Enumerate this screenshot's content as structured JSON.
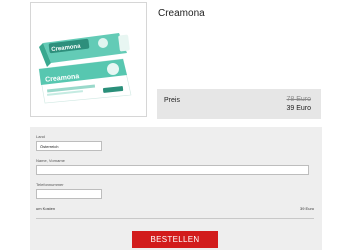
{
  "product": {
    "title": "Creamona",
    "image_alt": "Creamona tube and box",
    "tube_brand": "Creamona",
    "box_brand": "Creamona"
  },
  "price": {
    "label": "Preis",
    "old": "78 Euro",
    "new": "39 Euro"
  },
  "form": {
    "country": {
      "label": "Land",
      "value": "Österreich"
    },
    "name": {
      "label": "Name, Vorname",
      "value": ""
    },
    "phone": {
      "label": "Telefonnummer",
      "value": ""
    },
    "summary": {
      "label": "um Kosten",
      "value": "39 Euro"
    },
    "submit_label": "BESTELLEN"
  },
  "colors": {
    "accent_red": "#d21c1c",
    "teal": "#36c2a6",
    "panel_gray": "#eeeeee",
    "price_gray": "#e6e6e6"
  }
}
